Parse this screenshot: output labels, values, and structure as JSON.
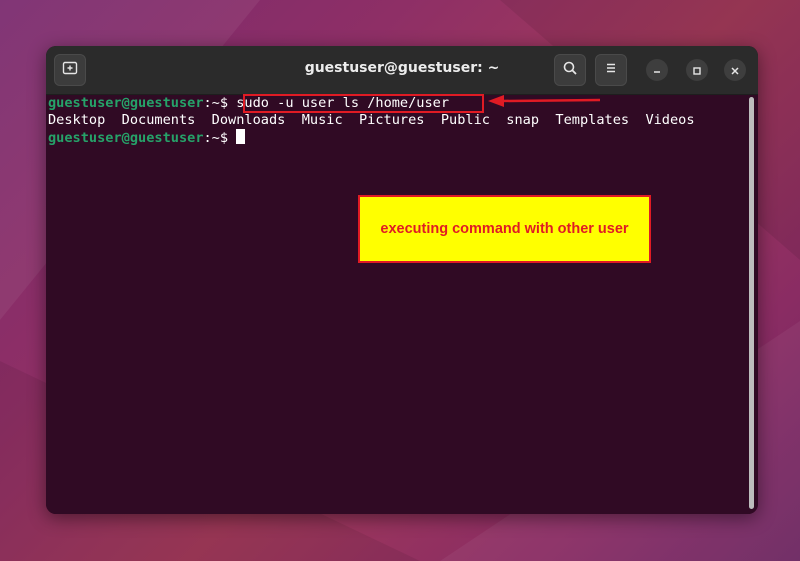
{
  "window": {
    "title": "guestuser@guestuser: ~"
  },
  "titlebar_icons": {
    "new_tab": "new-tab-icon",
    "search": "search-icon",
    "menu": "hamburger-menu-icon",
    "minimize": "minimize-icon",
    "maximize": "maximize-icon",
    "close": "close-icon"
  },
  "terminal": {
    "line1": {
      "prompt": "guestuser@guestuser",
      "separator": ":~$ ",
      "command": "sudo -u user ls /home/user"
    },
    "line2": {
      "output": "Desktop  Documents  Downloads  Music  Pictures  Public  snap  Templates  Videos"
    },
    "line3": {
      "prompt": "guestuser@guestuser",
      "separator": ":~$ "
    }
  },
  "annotation": {
    "callout_text": "executing command with other user",
    "highlight_color": "#e01b24",
    "callout_bg": "#ffff00"
  },
  "colors": {
    "terminal_bg": "#300a24",
    "prompt_green": "#26a269",
    "titlebar_bg": "#2b2b2b"
  }
}
